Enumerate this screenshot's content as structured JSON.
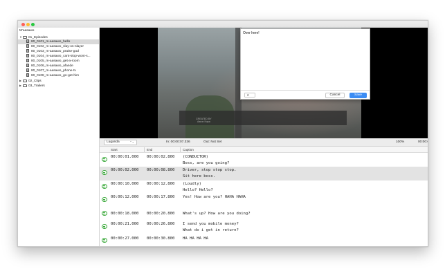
{
  "sidebar": {
    "project": "M'aasawo",
    "folders": [
      {
        "label": "01_Episodes",
        "expanded": true
      },
      {
        "label": "02_Clips",
        "expanded": false
      },
      {
        "label": "03_Trailers",
        "expanded": false
      }
    ],
    "episodes": [
      "80_0101_m-aasawo_hello",
      "80_0102_m-aasawo_slay-on-slayer",
      "80_0103_m-aasawo_praise-god",
      "80_0104_m-aasawo_cant-stop-wont-s...",
      "80_0105_m-aasawo_get-a-room",
      "80_0106_m-aasawo_afande",
      "80_0107_m-aasawo_phone-tv",
      "80_0108_m-aasawo_go-get-him"
    ],
    "selected_episode": "80_0101_m-aasawo_hello"
  },
  "video": {
    "watermark_line1": "CREATED BY",
    "watermark_line2": "Aaron Kaya"
  },
  "popover": {
    "text": "Over here!",
    "field_value": "2",
    "cancel_label": "Cancel",
    "save_label": "Save"
  },
  "controls": {
    "language": "Luganda",
    "in_label": "In: 00:00:07.336",
    "out_label": "Out: Not Set",
    "zoom": "100%",
    "duration": "00:00:08.425"
  },
  "table": {
    "headers": {
      "start": "Start",
      "end": "End",
      "caption": "Caption"
    },
    "rows": [
      {
        "start": "00:00:01.000",
        "end": "00:00:02.800",
        "line1": "(CONDUCTOR)",
        "line2": "Boss, are you going?"
      },
      {
        "start": "00:00:02.000",
        "end": "00:00:08.800",
        "line1": "Driver, stop stop stop.",
        "line2": "Sit here boss."
      },
      {
        "start": "00:00:10.000",
        "end": "00:00:12.800",
        "line1": "(Loudly)",
        "line2": "Hello? Hello?"
      },
      {
        "start": "00:00:12.000",
        "end": "00:00:17.800",
        "line1": "Yes! How are you? HAHA HAHA",
        "line2": ""
      },
      {
        "start": "00:00:18.000",
        "end": "00:00:20.800",
        "line1": "What's up? How are you doing?",
        "line2": ""
      },
      {
        "start": "00:00:21.000",
        "end": "00:00:26.800",
        "line1": "I send you mobile money?",
        "line2": "What do i get in return?"
      },
      {
        "start": "00:00:27.000",
        "end": "00:00:30.800",
        "line1": "HA HA HA HA",
        "line2": ""
      }
    ]
  },
  "colors": {
    "accent": "#3b8cf4",
    "row_icon": "#3aa93a",
    "selection": "#d9d9d9",
    "alt_row": "#e3e3e3"
  },
  "icons": {
    "caption_row": "speech-bubble-icon",
    "folder": "folder-icon",
    "file": "film-file-icon"
  }
}
